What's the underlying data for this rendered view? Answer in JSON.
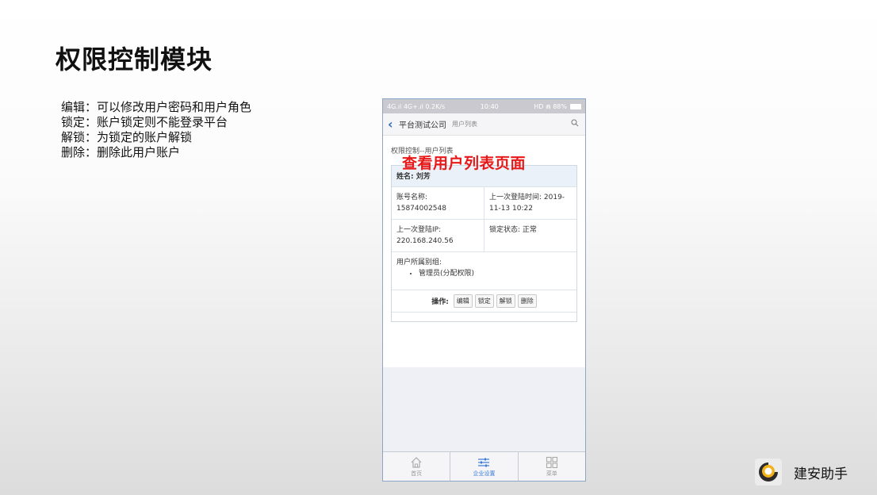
{
  "slide": {
    "title": "权限控制模块",
    "description": [
      "编辑：可以修改用户密码和用户角色",
      "锁定：账户锁定则不能登录平台",
      "解锁：为锁定的账户解锁",
      "删除：删除此用户账户"
    ],
    "caption": "查看用户列表页面"
  },
  "phone": {
    "status": {
      "network": "4G.ıl 4G+.ıl 0.2K/s",
      "time": "10:40",
      "right": "HD ⋒ 88%"
    },
    "nav": {
      "title": "平台测试公司",
      "subtitle": "用户列表"
    },
    "breadcrumb": "权限控制--用户列表",
    "user": {
      "name": "姓名: 刘芳",
      "account_label": "账号名称:",
      "account_value": "15874002548",
      "last_login_time": "上一次登陆时间: 2019-11-13 10:22",
      "ip_label": "上一次登陆IP:",
      "ip_value": "220.168.240.56",
      "lock_status": "锁定状态: 正常",
      "groups_label": "用户所属别组:",
      "groups": [
        "管理员(分配权限)"
      ]
    },
    "actions": {
      "label": "操作:",
      "edit": "编辑",
      "lock": "锁定",
      "unlock": "解锁",
      "delete": "删除"
    },
    "tabs": [
      {
        "label": "首页",
        "icon": "home-icon"
      },
      {
        "label": "企业设置",
        "icon": "settings-sliders-icon"
      },
      {
        "label": "菜单",
        "icon": "menu-grid-icon"
      }
    ]
  },
  "brand": {
    "name": "建安助手"
  }
}
